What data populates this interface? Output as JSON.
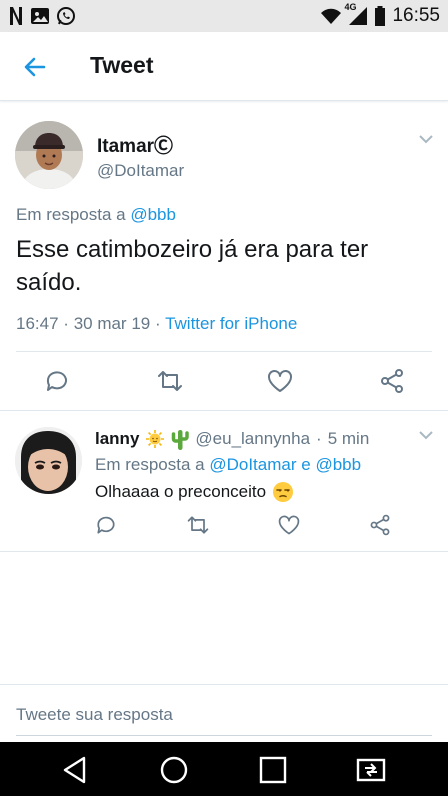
{
  "status_bar": {
    "time": "16:55",
    "network": "4G",
    "left_icons": [
      "netflix-icon",
      "gallery-icon",
      "whatsapp-icon"
    ],
    "right_icons": [
      "wifi-icon",
      "signal-icon",
      "battery-icon"
    ]
  },
  "header": {
    "title": "Tweet",
    "back_icon": "arrow-left-icon"
  },
  "tweet": {
    "display_name": "Itamar",
    "name_badge": "Ⓒ",
    "handle": "@DoItamar",
    "reply_prefix": "Em resposta a",
    "reply_to": "@bbb",
    "text": "Esse catimbozeiro já era para ter saído.",
    "time": "16:47",
    "date": "30 mar 19",
    "source": "Twitter for iPhone",
    "actions": [
      "reply-icon",
      "retweet-icon",
      "like-icon",
      "share-icon"
    ]
  },
  "reply": {
    "display_name": "lanny",
    "name_emojis": [
      "sun-emoji",
      "cactus-emoji"
    ],
    "handle": "@eu_lannynha",
    "age": "5 min",
    "reply_prefix": "Em resposta a",
    "reply_to_1": "@DoItamar",
    "reply_conjunction": "e",
    "reply_to_2": "@bbb",
    "text": "Olhaaaa o preconceito",
    "emoji": "unamused-face-emoji"
  },
  "composer": {
    "placeholder": "Tweete sua resposta"
  },
  "colors": {
    "accent": "#1b95e0",
    "muted": "#657786",
    "text": "#14171a"
  }
}
